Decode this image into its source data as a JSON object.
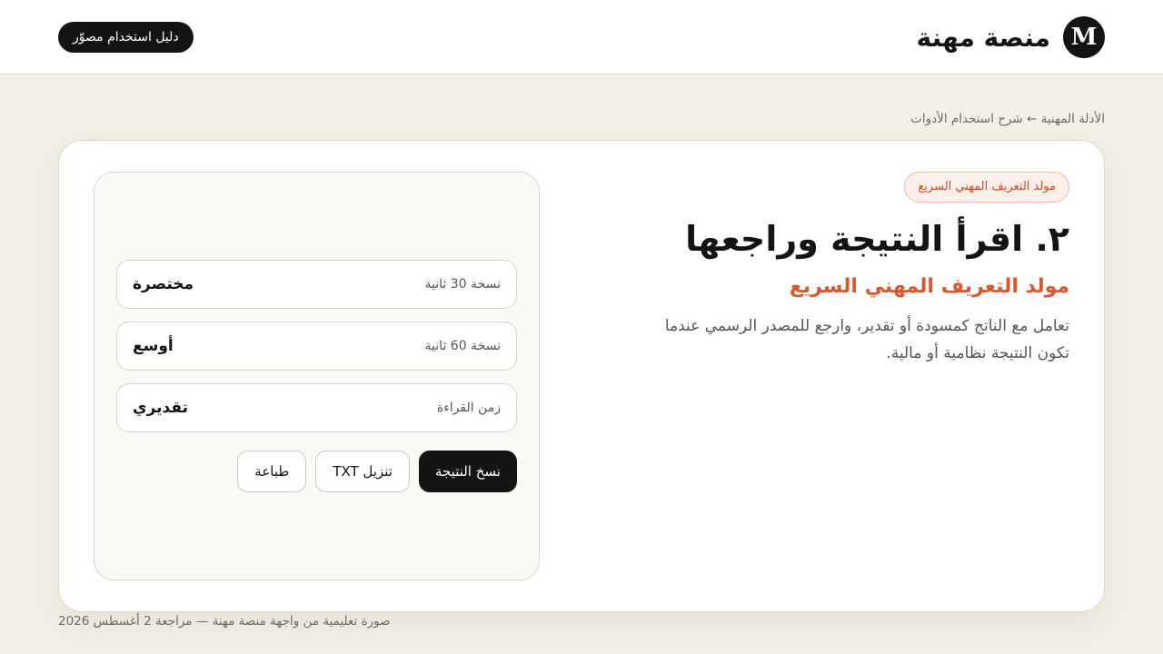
{
  "header": {
    "logo_letter": "M",
    "brand_name": "منصة مهنة",
    "guide_button_label": "دليل استخدام مصوّر"
  },
  "breadcrumb": "الأدلة المهنية ← شرح استخدام الأدوات",
  "intro": {
    "tag": "مولد التعريف المهني السريع",
    "step_title": "٢. اقرأ النتيجة وراجعها",
    "tool_name": "مولد التعريف المهني السريع",
    "description": "تعامل مع الناتج كمسودة أو تقدير، وارجع للمصدر الرسمي عندما تكون النتيجة نظامية أو مالية."
  },
  "result": {
    "rows": [
      {
        "label": "نسخة 30 ثانية",
        "value": "مختصرة"
      },
      {
        "label": "نسخة 60 ثانية",
        "value": "أوسع"
      },
      {
        "label": "زمن القراءة",
        "value": "تقديري"
      }
    ],
    "actions": {
      "copy_label": "نسخ النتيجة",
      "download_label": "تنزيل TXT",
      "print_label": "طباعة"
    }
  },
  "footer": "صورة تعليمية من واجهة منصة مهنة — مراجعة 2 أغسطس 2026",
  "colors": {
    "page_background": "#f4f0e7",
    "accent": "#d9572e",
    "dark": "#141414"
  }
}
